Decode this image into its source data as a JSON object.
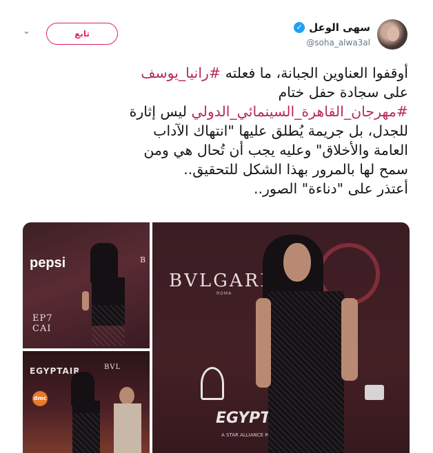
{
  "user": {
    "display_name": "سهى الوعل",
    "handle": "@soha_alwa3al",
    "verified_glyph": "✓"
  },
  "follow_button": {
    "label": "تابع"
  },
  "menu": {
    "caret_glyph": "⌄"
  },
  "tweet": {
    "line1_prefix": "أوقفوا العناوين الجبانة، ما فعلته ",
    "line1_hashtag": "#رانيا_يوسف",
    "line2": "على سجادة حفل ختام",
    "line3_hashtag": "#مهرجان_القاهرة_السينمائي_الدولي",
    "line3_suffix": " ليس إثارة",
    "line4": "للجدل، بل جريمة يُطلق عليها \"انتهاك الآداب",
    "line5": "العامة والأخلاق\" وعليه يجب أن تُحال هي ومن",
    "line6": "سمح لها بالمرور بهذا الشكل للتحقيق..",
    "line7": "أعتذر على \"دناءة\" الصور.."
  },
  "media": {
    "img1": {
      "sponsor_text": "pepsi",
      "badge_text": "EP7",
      "badge_text2": "CAI",
      "side_letter": "B"
    },
    "img2": {
      "sponsor_text": "EGYPTAIR",
      "badge_text": "dmc",
      "side_text": "BVL"
    },
    "img3": {
      "brand_text": "BVLGARI",
      "brand_sub": "ROMA",
      "sponsor_text": "EGYPTAIR",
      "sponsor_sub": "A STAR ALLIANCE MEMBER"
    }
  },
  "colors": {
    "accent": "#e0245e",
    "hashtag": "#b7295a",
    "verified": "#1da1f2",
    "secondary_text": "#657786"
  },
  "icons": [
    "verified-badge-icon",
    "chevron-down-icon"
  ]
}
